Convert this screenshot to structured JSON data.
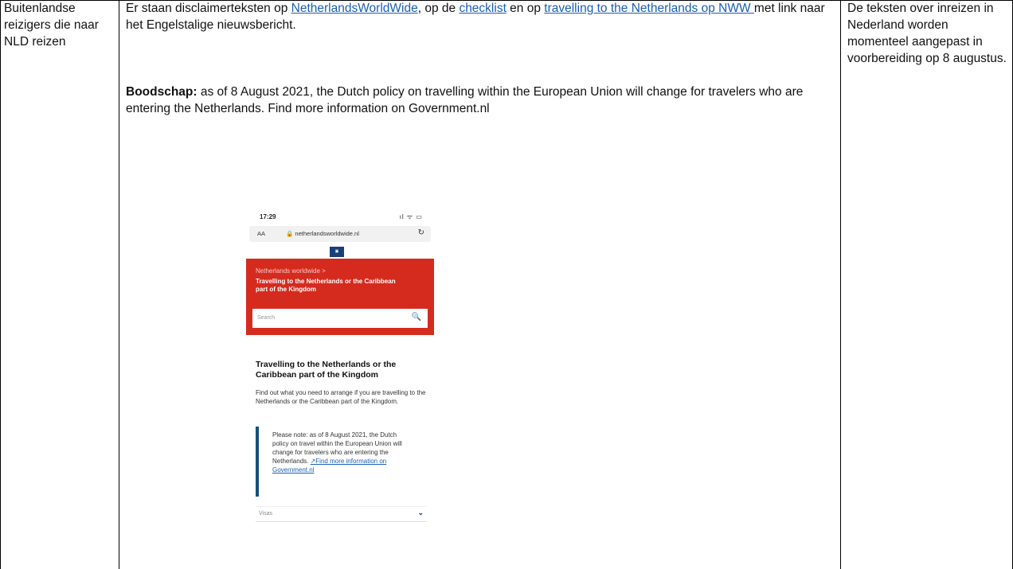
{
  "row": {
    "group": "Buitenlandse reizigers die naar NLD reizen",
    "col2": {
      "intro_before": "Er staan disclaimerteksten op ",
      "link1": "NetherlandsWorldWide",
      "intro_mid1": ", op de ",
      "link2": "checklist",
      "intro_mid2": " en op ",
      "link3": "travelling to the Netherlands op NWW ",
      "intro_after": " met link naar het Engelstalige nieuwsbericht.",
      "boodschap_label": "Boodschap:",
      "boodschap_text": " as of 8 August 2021, the Dutch policy on travelling within the European Union will change for travelers who are entering the Netherlands. Find more information on Government.nl"
    },
    "col3": "De teksten over inreizen in Nederland worden momenteel aangepast in voorbereiding op 8 augustus."
  },
  "phone": {
    "time": "17:29",
    "signal": "ıl ᯤ ▭",
    "aa": "AA",
    "url": "🔒 netherlandsworldwide.nl",
    "reload_icon": "↻",
    "breadcrumb": "Netherlands worldwide >",
    "hero_title": "Travelling to the Netherlands or the Caribbean part of the Kingdom",
    "search_placeholder": "Search",
    "search_icon": "🔍",
    "page_title": "Travelling to the Netherlands or the Caribbean part of the Kingdom",
    "page_desc": "Find out what you need to arrange if you are travelling to the Netherlands or the Caribbean part of the Kingdom.",
    "note_text": "Please note: as of 8 August 2021, the Dutch policy on travel within the European Union will change for travelers who are entering the Netherlands. ",
    "note_link": "↗Find more information on Government.nl",
    "visas_label": "Visas",
    "chevron_icon": "⌄"
  }
}
